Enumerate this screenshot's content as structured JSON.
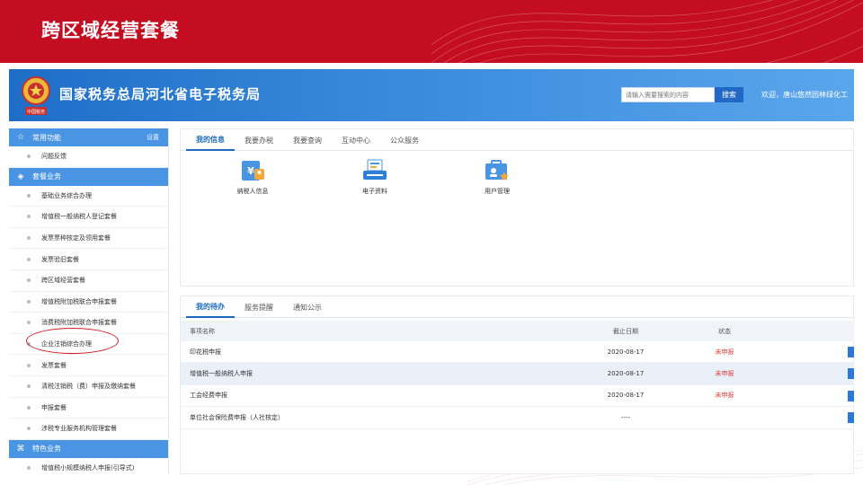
{
  "slide": {
    "title": "跨区域经营套餐"
  },
  "portal": {
    "site_name": "国家税务总局河北省电子税务局",
    "emblem_caption": "中国税务",
    "search": {
      "placeholder": "请输入需要搜索的内容",
      "button_label": "搜索"
    },
    "welcome_text": "欢迎，唐山悠然园林绿化工"
  },
  "sidebar": {
    "sections": [
      {
        "label": "常用功能",
        "icon": "star-icon",
        "setting": "设置"
      },
      {
        "label": "套餐业务",
        "icon": "layers-icon"
      },
      {
        "label": "特色业务",
        "icon": "cluster-icon"
      }
    ],
    "common_items": [
      "问题反馈"
    ],
    "package_items": [
      "基础业务综合办理",
      "增值税一般纳税人登记套餐",
      "发票票种核定及领用套餐",
      "发票验旧套餐",
      "跨区域经营套餐",
      "增值税附加税联合申报套餐",
      "消费税附加税联合申报套餐",
      "企业注销综合办理",
      "发票套餐",
      "清税注销税（费）申报及缴纳套餐",
      "申报套餐",
      "涉税专业服务机构管理套餐"
    ],
    "special_items": [
      "增值税小规模纳税人申报(引导式)"
    ]
  },
  "info_panel": {
    "tabs": [
      "我的信息",
      "我要办税",
      "我要查询",
      "互动中心",
      "公众服务"
    ],
    "active_tab": 0,
    "quick_links": [
      {
        "label": "纳税人信息",
        "icon": "taxpayer-info-icon"
      },
      {
        "label": "电子资料",
        "icon": "electronic-data-icon"
      },
      {
        "label": "用户管理",
        "icon": "user-management-icon"
      }
    ]
  },
  "todo_panel": {
    "tabs": [
      "我的待办",
      "服务提醒",
      "通知公示"
    ],
    "active_tab": 0,
    "columns": [
      "事项名称",
      "截止日期",
      "状态"
    ],
    "rows": [
      {
        "name": "印花税申报",
        "deadline": "2020-08-17",
        "status": "未申报"
      },
      {
        "name": "增值税一般纳税人申报",
        "deadline": "2020-08-17",
        "status": "未申报"
      },
      {
        "name": "工会经费申报",
        "deadline": "2020-08-17",
        "status": "未申报"
      },
      {
        "name": "单位社会保险费申报（人社核定）",
        "deadline": "----",
        "status": ""
      }
    ]
  },
  "colors": {
    "banner_red": "#c40d21",
    "header_blue": "#2a7bd4",
    "sidebar_head_blue": "#4a95e3",
    "active_tab_blue": "#1c6ac0",
    "status_red": "#e23c3c",
    "highlight_red": "#d21c23"
  }
}
